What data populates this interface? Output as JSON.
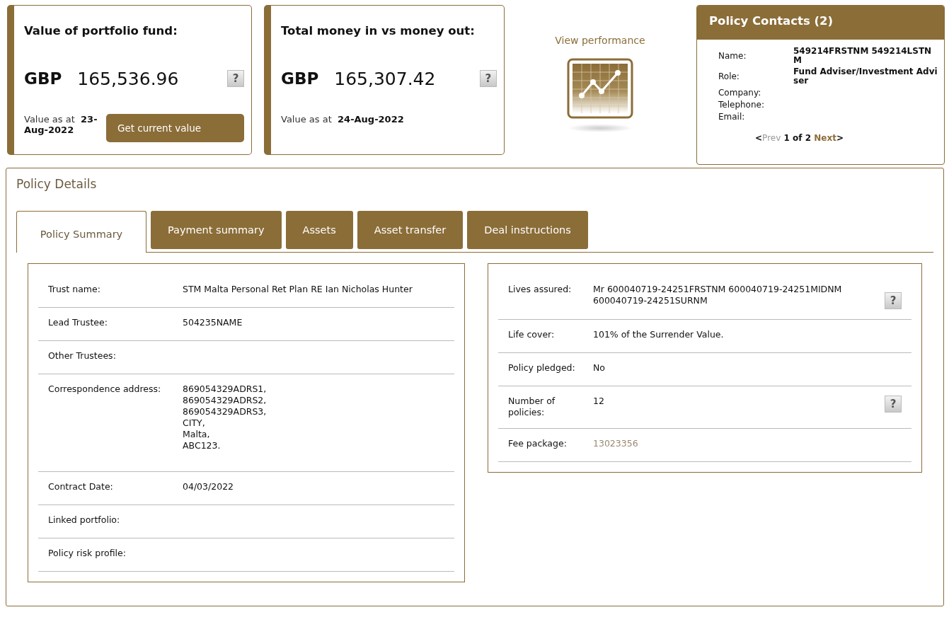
{
  "value_cards": [
    {
      "title": "Value of portfolio fund:",
      "currency": "GBP",
      "amount": "165,536.96",
      "help": "?",
      "as_at_label": "Value as at",
      "as_at_date": "23-Aug-2022",
      "button": "Get current value"
    },
    {
      "title": "Total money in vs money out:",
      "currency": "GBP",
      "amount": "165,307.42",
      "help": "?",
      "as_at_label": "Value as at",
      "as_at_date": "24-Aug-2022"
    }
  ],
  "performance": {
    "label": "View performance"
  },
  "policy_contacts": {
    "title": "Policy Contacts (2)",
    "fields": [
      {
        "label": "Name:",
        "value": "549214FRSTNM 549214LSTNM"
      },
      {
        "label": "Role:",
        "value": "Fund Adviser/Investment Adviser"
      },
      {
        "label": "Company:"
      },
      {
        "label": "Telephone:"
      },
      {
        "label": "Email:"
      }
    ],
    "pager": {
      "prev_arrow": "<",
      "prev": {
        "label": "Prev",
        "disabled": true
      },
      "position": "1 of 2",
      "next": {
        "label": "Next",
        "disabled": false
      },
      "next_arrow": ">"
    }
  },
  "policy_details": {
    "title": "Policy Details",
    "tabs": [
      {
        "label": "Policy Summary",
        "selected": true
      },
      {
        "label": "Payment summary",
        "selected": false
      },
      {
        "label": "Assets",
        "selected": false
      },
      {
        "label": "Asset transfer",
        "selected": false
      },
      {
        "label": "Deal instructions",
        "selected": false
      }
    ],
    "left_rows": [
      {
        "label": "Trust name:",
        "lines": [
          "STM Malta Personal Ret Plan RE Ian Nicholas Hunter"
        ]
      },
      {
        "label": "Lead Trustee:",
        "lines": [
          "504235NAME"
        ]
      },
      {
        "label": "Other Trustees:",
        "lines": []
      },
      {
        "label": "Correspondence address:",
        "lines": [
          "869054329ADRS1,",
          "869054329ADRS2,",
          "869054329ADRS3,",
          "CITY,",
          "Malta,",
          "ABC123."
        ]
      },
      {
        "label": "Contract Date:",
        "lines": [
          "04/03/2022"
        ]
      },
      {
        "label": "Linked portfolio:",
        "lines": []
      },
      {
        "label": "Policy risk profile:",
        "lines": []
      }
    ],
    "right_rows": [
      {
        "label": "Lives assured:",
        "value": "Mr 600040719-24251FRSTNM 600040719-24251MIDNM 600040719-24251SURNM",
        "help": "?",
        "kind": "text"
      },
      {
        "label": "Life cover:",
        "value": "101% of the Surrender Value.",
        "kind": "text"
      },
      {
        "label": "Policy pledged:",
        "value": "No",
        "kind": "text"
      },
      {
        "label": "Number of policies:",
        "value": "12",
        "help": "?",
        "kind": "text"
      },
      {
        "label": "Fee package:",
        "value": "13023356",
        "kind": "link"
      }
    ]
  }
}
